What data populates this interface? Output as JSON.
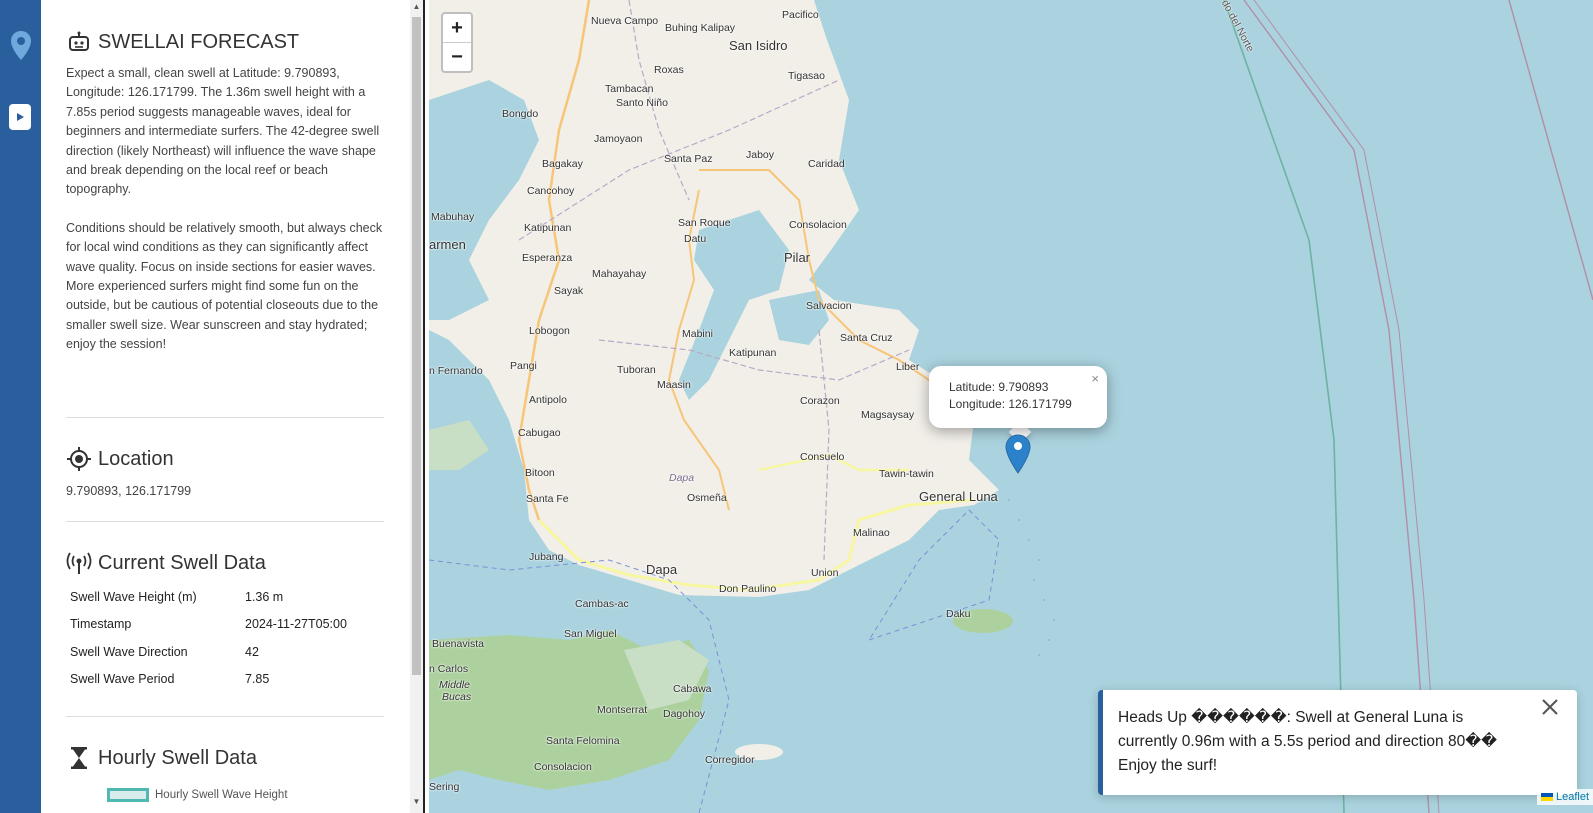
{
  "rail": {
    "location_icon": "map-pin-icon",
    "play_icon": "play-icon"
  },
  "forecast": {
    "title": "SWELLAI FORECAST",
    "icon": "robot-icon",
    "paragraph_1": "Expect a small, clean swell at Latitude: 9.790893, Longitude: 126.171799. The 1.36m swell height with a 7.85s period suggests manageable waves, ideal for beginners and intermediate surfers. The 42-degree swell direction (likely Northeast) will influence the wave shape and break depending on the local reef or beach topography.",
    "paragraph_2": "Conditions should be relatively smooth, but always check for local wind conditions as they can significantly affect wave quality. Focus on inside sections for easier waves. More experienced surfers might find some fun on the outside, but be cautious of potential closeouts due to the smaller swell size. Wear sunscreen and stay hydrated; enjoy the session!"
  },
  "location": {
    "title": "Location",
    "icon": "target-icon",
    "coords": "9.790893, 126.171799"
  },
  "current": {
    "title": "Current Swell Data",
    "icon": "broadcast-icon",
    "rows": [
      {
        "key": "Swell Wave Height (m)",
        "value": "1.36 m"
      },
      {
        "key": "Timestamp",
        "value": "2024-11-27T05:00"
      },
      {
        "key": "Swell Wave Direction",
        "value": "42"
      },
      {
        "key": "Swell Wave Period",
        "value": "7.85"
      }
    ]
  },
  "hourly": {
    "title": "Hourly Swell Data",
    "icon": "hourglass-icon",
    "legend": "Hourly Swell Wave Height",
    "legend_color": "#4fb8b2"
  },
  "map": {
    "zoom_in": "+",
    "zoom_out": "−",
    "places": [
      {
        "name": "Nueva Campo"
      },
      {
        "name": "Buhing Kalipay"
      },
      {
        "name": "Pacifico"
      },
      {
        "name": "San Isidro"
      },
      {
        "name": "Roxas"
      },
      {
        "name": "Tigasao"
      },
      {
        "name": "Tambacan"
      },
      {
        "name": "Santo Niño"
      },
      {
        "name": "Bongdo"
      },
      {
        "name": "Jamoyaon"
      },
      {
        "name": "Jaboy"
      },
      {
        "name": "Bagakay"
      },
      {
        "name": "Santa Paz"
      },
      {
        "name": "Caridad"
      },
      {
        "name": "Cancohoy"
      },
      {
        "name": "Mabuhay"
      },
      {
        "name": "Katipunan"
      },
      {
        "name": "San Roque"
      },
      {
        "name": "Consolacion"
      },
      {
        "name": "Datu"
      },
      {
        "name": "armen"
      },
      {
        "name": "Esperanza"
      },
      {
        "name": "Pilar"
      },
      {
        "name": "Mahayahay"
      },
      {
        "name": "Sayak"
      },
      {
        "name": "Salvacion"
      },
      {
        "name": "Lobogon"
      },
      {
        "name": "Mabini"
      },
      {
        "name": "Santa Cruz"
      },
      {
        "name": "Katipunan"
      },
      {
        "name": "Pangi"
      },
      {
        "name": "Tuboran"
      },
      {
        "name": "Liber"
      },
      {
        "name": "n Fernando"
      },
      {
        "name": "Maasin"
      },
      {
        "name": "Antipolo"
      },
      {
        "name": "Corazon"
      },
      {
        "name": "Magsaysay"
      },
      {
        "name": "Cabugao"
      },
      {
        "name": "Consuelo"
      },
      {
        "name": "Dapa"
      },
      {
        "name": "Tawin-tawin"
      },
      {
        "name": "Bitoon"
      },
      {
        "name": "General Luna"
      },
      {
        "name": "Santa Fe"
      },
      {
        "name": "Osmeña"
      },
      {
        "name": "Malinao"
      },
      {
        "name": "Jubang"
      },
      {
        "name": "Dapa"
      },
      {
        "name": "Union"
      },
      {
        "name": "Don Paulino"
      },
      {
        "name": "Cambas-ac"
      },
      {
        "name": "Daku"
      },
      {
        "name": "San Miguel"
      },
      {
        "name": "Buenavista"
      },
      {
        "name": "n Carlos"
      },
      {
        "name": "Middle"
      },
      {
        "name": "Bucas"
      },
      {
        "name": "Cabawa"
      },
      {
        "name": "Montserrat"
      },
      {
        "name": "Dagohoy"
      },
      {
        "name": "Santa Felomina"
      },
      {
        "name": "Corregidor"
      },
      {
        "name": "Consolacion"
      },
      {
        "name": "Sering"
      },
      {
        "name": "do del Norte"
      }
    ],
    "popup": {
      "line1": "Latitude: 9.790893",
      "line2": "Longitude: 126.171799",
      "close": "×"
    },
    "marker_icon": "map-marker-icon",
    "attribution": "Leaflet"
  },
  "toast": {
    "text": "Heads Up ������: Swell at General Luna is currently 0.96m with a 5.5s period and direction 80�� Enjoy the surf!",
    "close_icon": "close-icon"
  }
}
